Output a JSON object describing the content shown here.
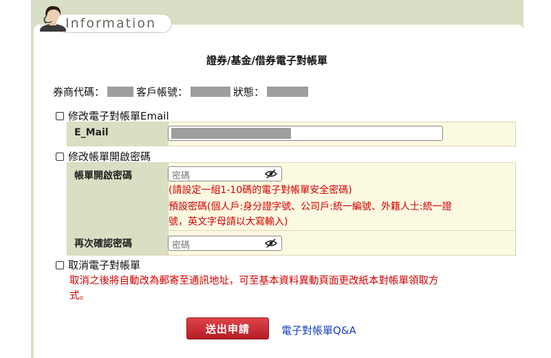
{
  "header": {
    "title": "Information"
  },
  "page_title": "證券/基金/借券電子對帳單",
  "account_info": {
    "broker_code_label": "券商代碼：",
    "account_no_label": "客戶帳號：",
    "status_label": "狀態："
  },
  "email_section": {
    "checkbox_label": "修改電子對帳單Email",
    "field_label": "E_Mail"
  },
  "password_section": {
    "checkbox_label": "修改帳單開啟密碼",
    "password_label": "帳單開啟密碼",
    "password_placeholder": "密碼",
    "hint_line1": "(請設定一組1-10碼的電子對帳單安全密碼)",
    "hint_line2": "預設密碼(個人戶:身分證字號、公司戶:統一編號、外籍人士:統一證",
    "hint_line3": "號，英文字母請以大寫輸入)",
    "confirm_label": "再次確認密碼",
    "confirm_placeholder": "密碼"
  },
  "cancel_section": {
    "checkbox_label": "取消電子對帳單",
    "note_line1": "取消之後將自動改為郵寄至通訊地址，可至基本資料異動頁面更改紙本對帳單領取方",
    "note_line2": "式。"
  },
  "actions": {
    "submit_label": "送出申請",
    "qa_link_label": "電子對帳單Q&A"
  },
  "colors": {
    "label_bg": "#d9dfc2",
    "value_bg": "#fcf9e1",
    "warning_text": "#d10000",
    "link": "#1a3fc0",
    "submit_bg": "#c9282e"
  },
  "icons": {
    "password_toggle": "eye-slash-icon",
    "header": "customer-service-agent-icon"
  }
}
